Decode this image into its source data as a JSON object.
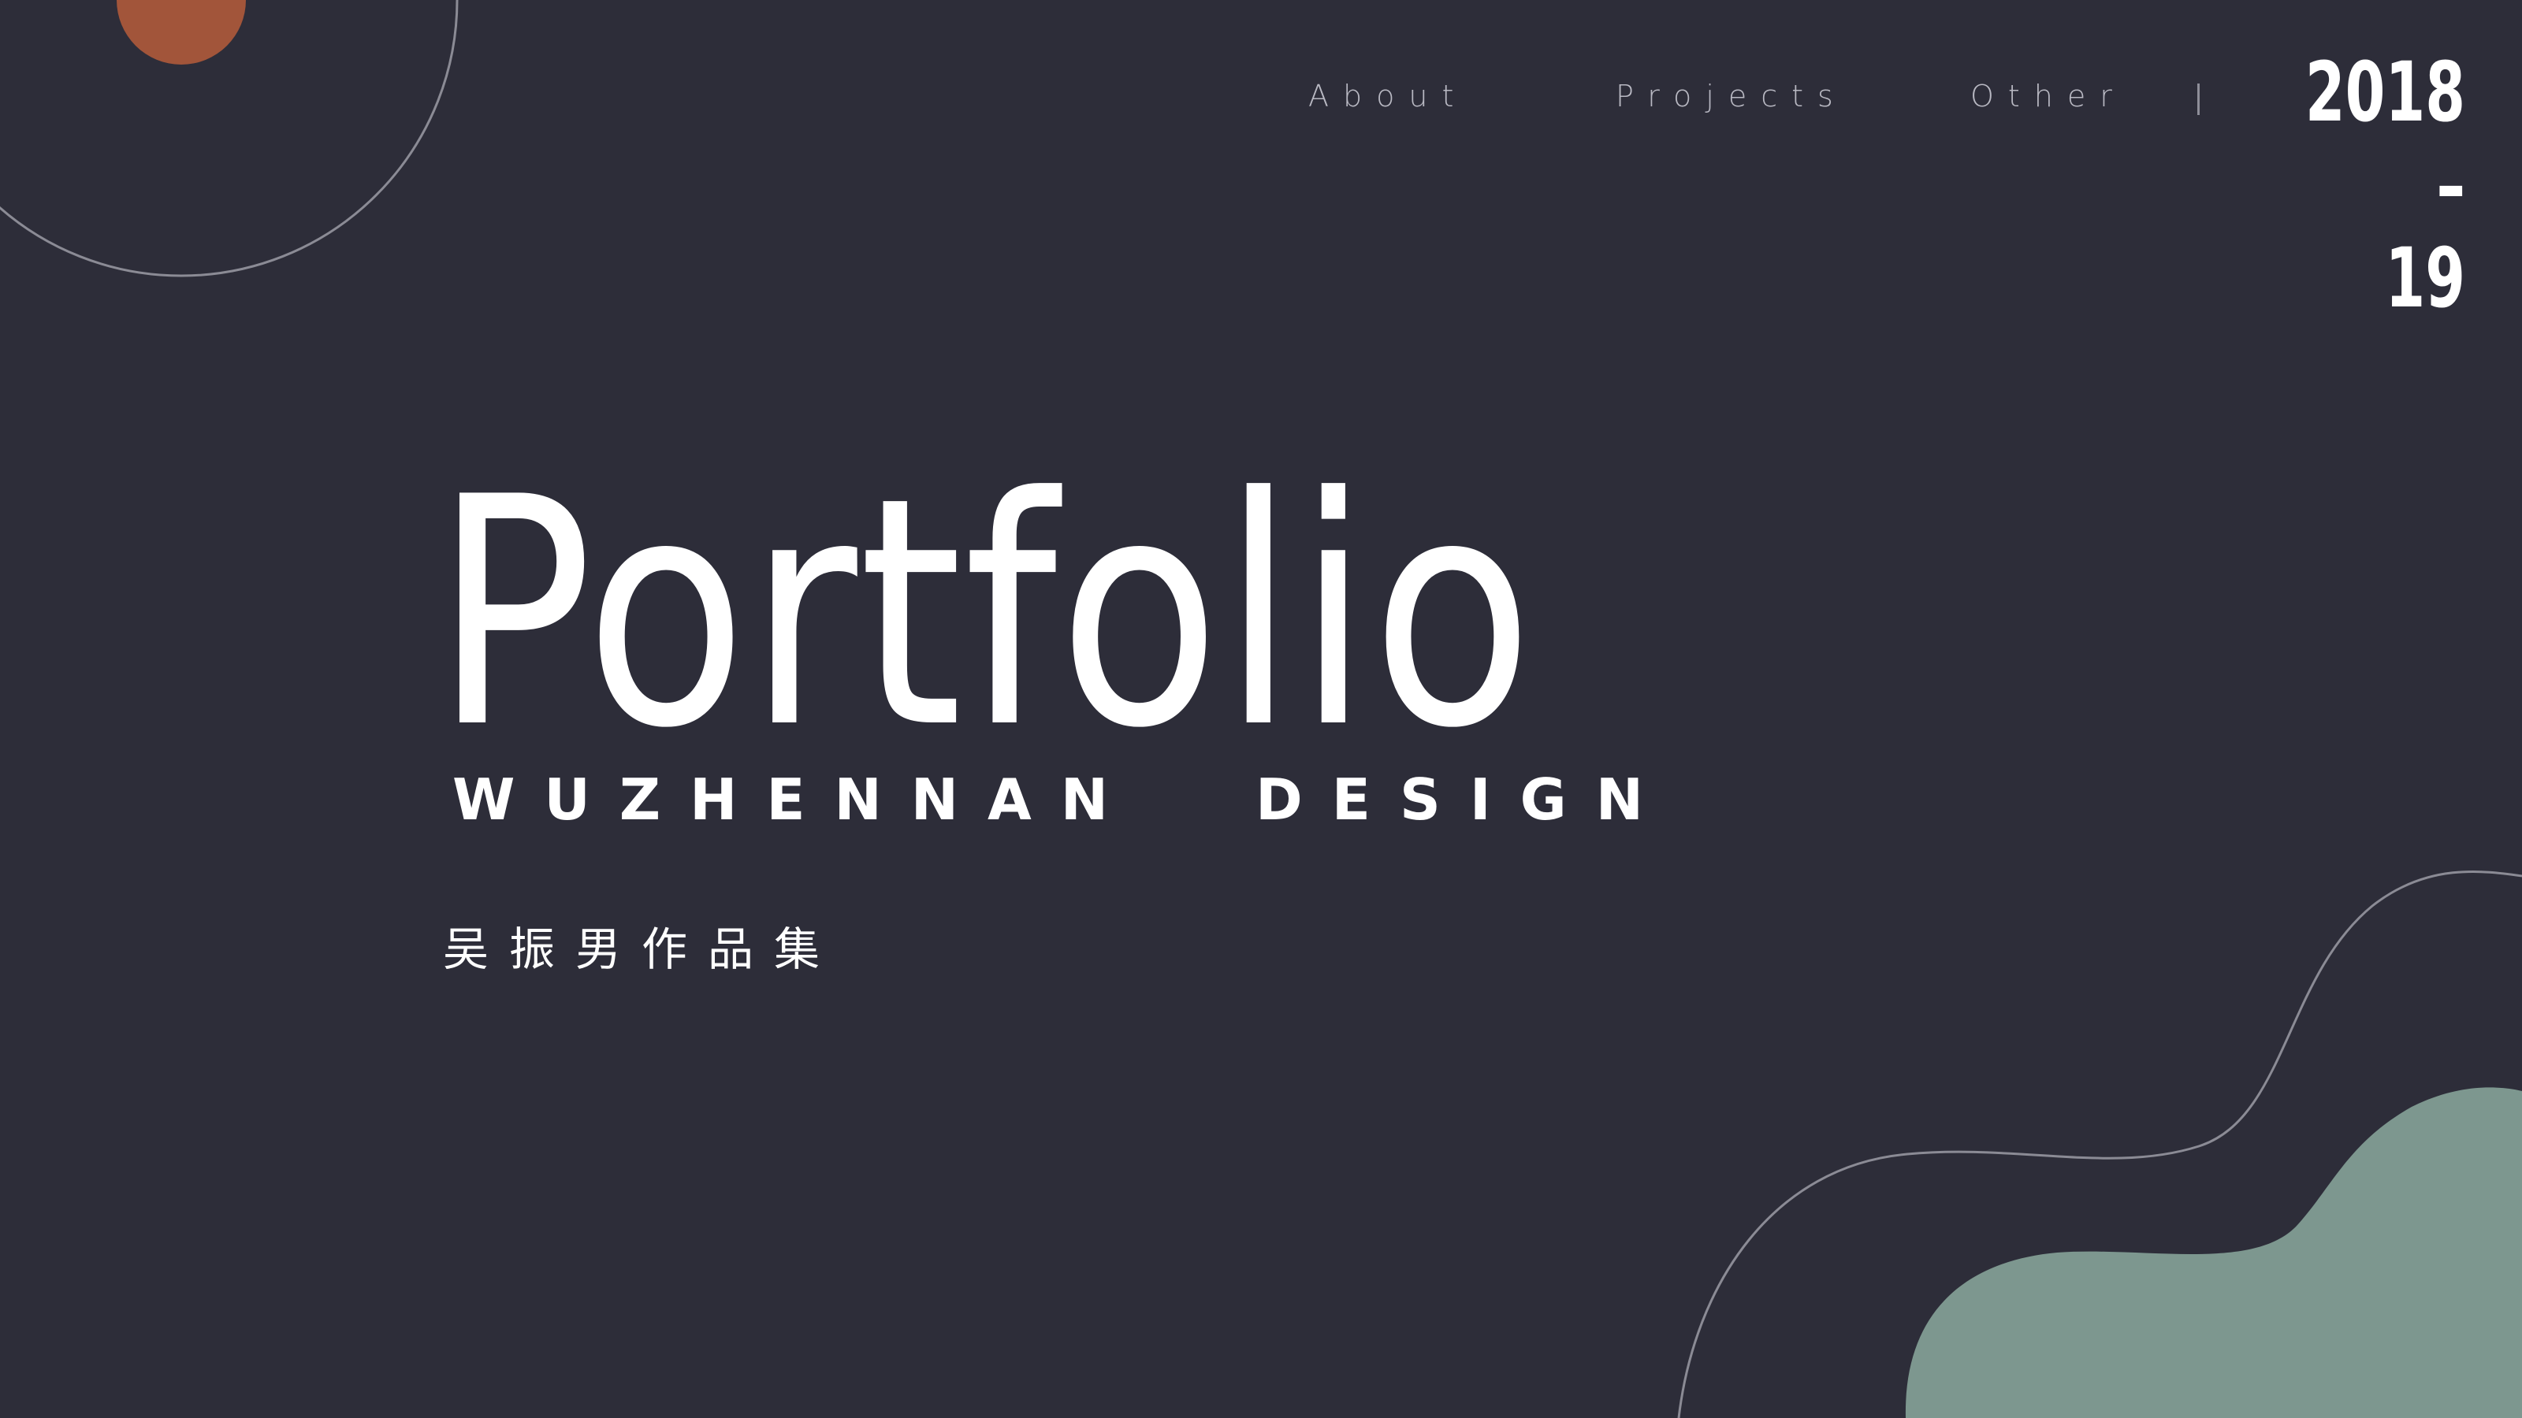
{
  "nav": {
    "about": "About",
    "projects": "Projects",
    "other": "Other",
    "divider": "|"
  },
  "year": {
    "line1": "2018 –",
    "line2": "19"
  },
  "hero": {
    "title": "Portfolio",
    "subtitle_name": "WUZHENNAN",
    "subtitle_word": "DESIGN",
    "chinese": "吴振男作品集"
  },
  "colors": {
    "background": "#2d2d39",
    "accent_orange": "#a2553a",
    "accent_green": "#7d978f",
    "outline_stroke": "#8b8b95",
    "text": "#ffffff"
  }
}
